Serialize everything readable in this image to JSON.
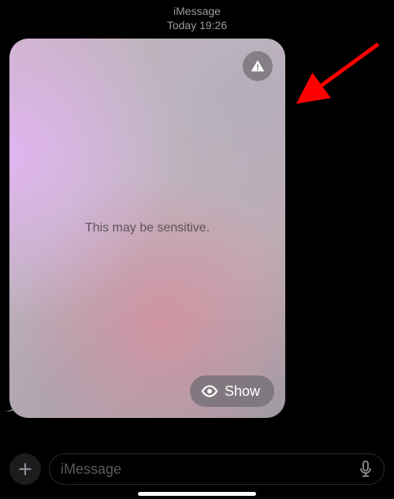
{
  "header": {
    "service": "iMessage",
    "timestamp": "Today 19:26"
  },
  "message": {
    "sensitive_label": "This may be sensitive.",
    "show_button_label": "Show",
    "warning_icon": "warning-icon",
    "show_icon": "eye-icon"
  },
  "composer": {
    "plus_icon": "plus-icon",
    "placeholder": "iMessage",
    "dictate_icon": "microphone-icon"
  },
  "annotation": {
    "arrow_color": "#ff0000"
  }
}
